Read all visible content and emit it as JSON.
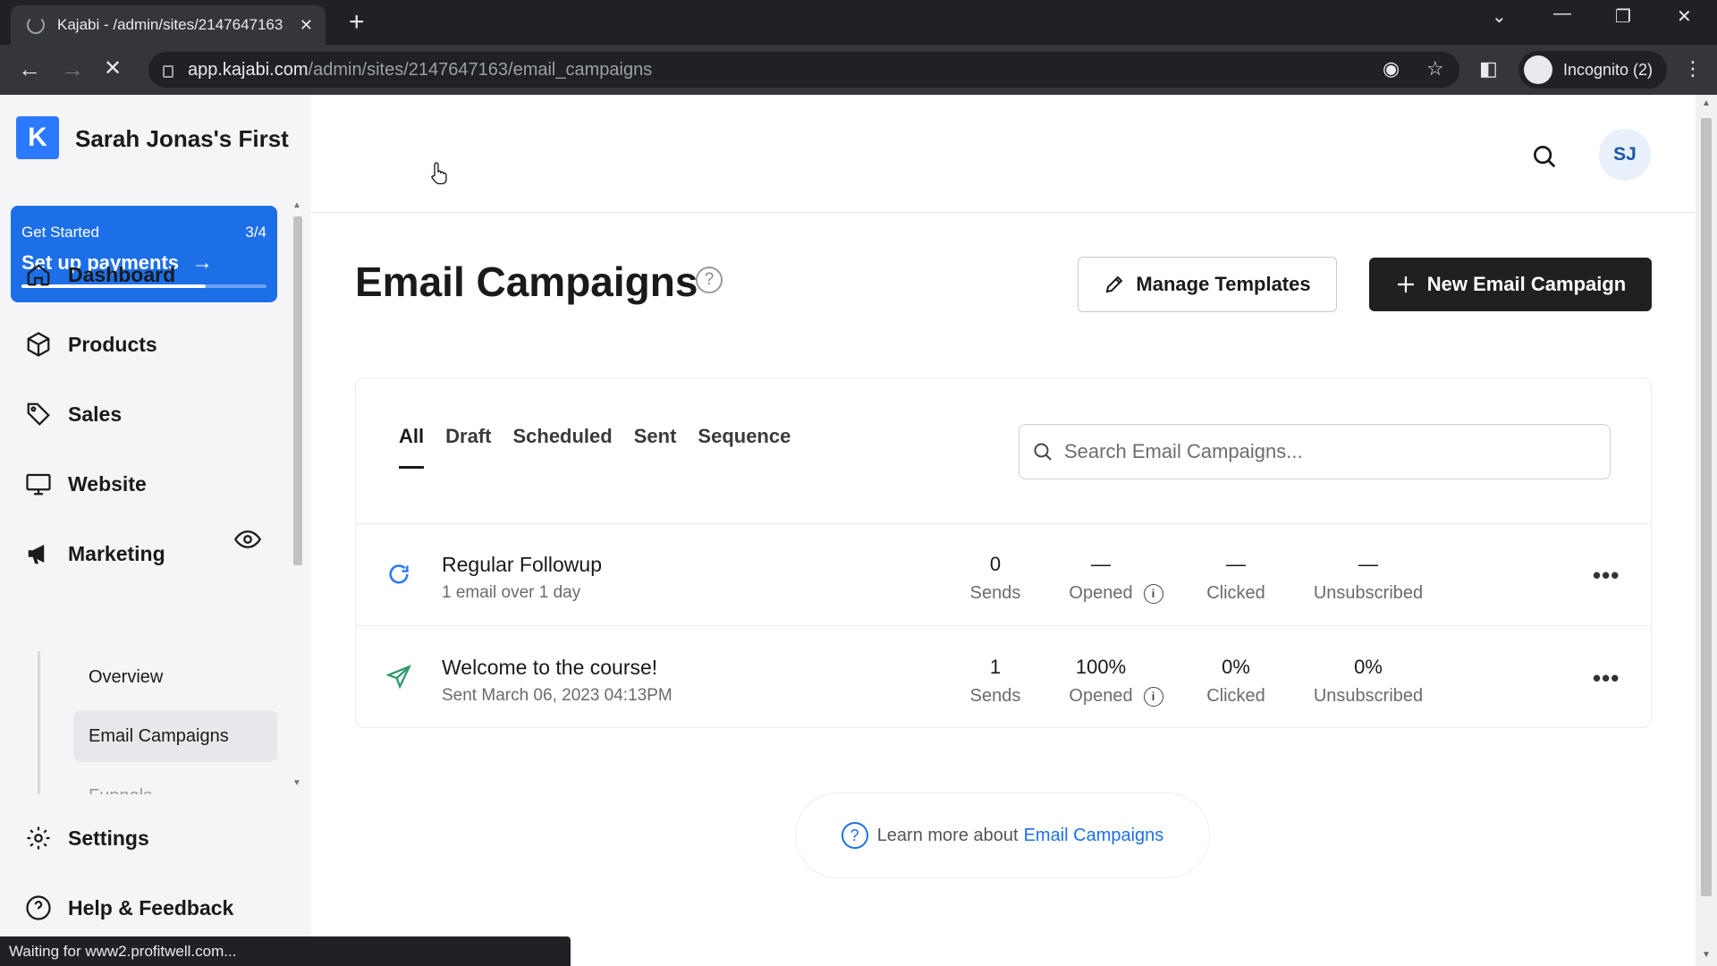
{
  "browser": {
    "tab_title": "Kajabi - /admin/sites/2147647163",
    "url_host": "app.kajabi.com",
    "url_path": "/admin/sites/2147647163/email_campaigns",
    "incognito_label": "Incognito (2)",
    "status_text": "Waiting for www2.profitwell.com..."
  },
  "sidebar": {
    "site_name": "Sarah Jonas's First",
    "get_started": {
      "label": "Get Started",
      "count": "3/4",
      "title": "Set up payments",
      "progress": 0.75
    },
    "nav": [
      {
        "label": "Dashboard",
        "icon": "home-icon"
      },
      {
        "label": "Products",
        "icon": "box-icon"
      },
      {
        "label": "Sales",
        "icon": "tag-icon"
      },
      {
        "label": "Website",
        "icon": "monitor-icon"
      },
      {
        "label": "Marketing",
        "icon": "megaphone-icon"
      },
      {
        "label": "Settings",
        "icon": "gear-icon"
      },
      {
        "label": "Help & Feedback",
        "icon": "help-circle-icon"
      }
    ],
    "marketing_sub": [
      {
        "label": "Overview",
        "active": false
      },
      {
        "label": "Email Campaigns",
        "active": true
      },
      {
        "label": "Funnels",
        "active": false
      }
    ]
  },
  "header": {
    "avatar_initials": "SJ"
  },
  "main": {
    "title": "Email Campaigns",
    "manage_templates_label": "Manage Templates",
    "new_campaign_label": "New Email Campaign",
    "tabs": [
      {
        "label": "All",
        "active": true
      },
      {
        "label": "Draft",
        "active": false
      },
      {
        "label": "Scheduled",
        "active": false
      },
      {
        "label": "Sent",
        "active": false
      },
      {
        "label": "Sequence",
        "active": false
      }
    ],
    "search_placeholder": "Search Email Campaigns...",
    "stat_labels": {
      "sends": "Sends",
      "opened": "Opened",
      "clicked": "Clicked",
      "unsubscribed": "Unsubscribed"
    },
    "campaigns": [
      {
        "name": "Regular Followup",
        "subtitle": "1 email over 1 day",
        "type": "sequence",
        "sends": "0",
        "opened": "—",
        "clicked": "—",
        "unsubscribed": "—"
      },
      {
        "name": "Welcome to the course!",
        "subtitle": "Sent March 06, 2023 04:13PM",
        "type": "sent",
        "sends": "1",
        "opened": "100%",
        "clicked": "0%",
        "unsubscribed": "0%"
      }
    ],
    "learn_more_text": "Learn more about",
    "learn_more_link": "Email Campaigns"
  },
  "colors": {
    "brand_blue": "#1d6fe8",
    "primary_button": "#1f2022",
    "sequence_icon": "#2b79ff",
    "sent_icon": "#2e9b6a"
  }
}
